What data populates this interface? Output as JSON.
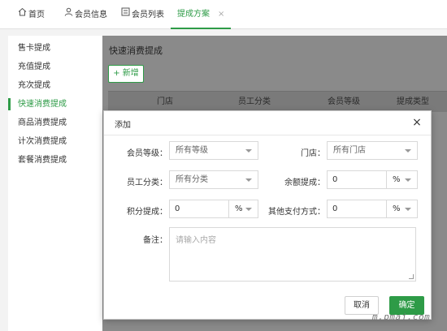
{
  "tabs": [
    {
      "label": "首页",
      "icon": "home-icon"
    },
    {
      "label": "会员信息",
      "icon": "user-icon"
    },
    {
      "label": "会员列表",
      "icon": "list-icon"
    },
    {
      "label": "提成方案",
      "icon": "",
      "active": true,
      "close": "×"
    }
  ],
  "sidebar": {
    "items": [
      {
        "label": "售卡提成"
      },
      {
        "label": "充值提成"
      },
      {
        "label": "充次提成"
      },
      {
        "label": "快速消费提成",
        "active": true
      },
      {
        "label": "商品消费提成"
      },
      {
        "label": "计次消费提成"
      },
      {
        "label": "套餐消费提成"
      }
    ]
  },
  "main": {
    "title": "快速消费提成",
    "add_button": "+ 新增",
    "columns": [
      "门店",
      "员工分类",
      "会员等级",
      "提成类型"
    ]
  },
  "dialog": {
    "title": "添加",
    "close": "×",
    "member_level": {
      "label": "会员等级：",
      "value": "所有等级"
    },
    "store": {
      "label": "门店：",
      "value": "所有门店"
    },
    "staff_category": {
      "label": "员工分类：",
      "value": "所有分类"
    },
    "balance_commission": {
      "label": "余额提成：",
      "value": "0",
      "unit": "%"
    },
    "points_commission": {
      "label": "积分提成：",
      "value": "0",
      "unit": "%"
    },
    "other_payment": {
      "label": "其他支付方式：",
      "value": "0",
      "unit": "%"
    },
    "remark": {
      "label": "备注：",
      "placeholder": "请输入内容"
    },
    "cancel_button": "取消",
    "ok_button": "确定"
  },
  "watermark": "m.pmaj.com",
  "colors": {
    "accent": "#2e9b47",
    "overlay": "#8a8a8a"
  }
}
